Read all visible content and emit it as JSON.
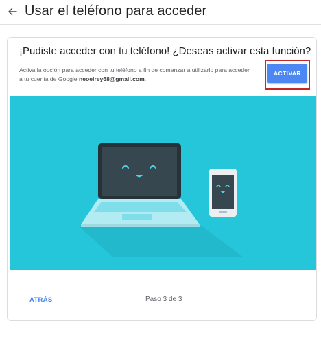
{
  "header": {
    "title": "Usar el teléfono para acceder",
    "back_icon": "arrow-left-icon"
  },
  "card": {
    "heading": "¡Pudiste acceder con tu teléfono! ¿Deseas activar esta función?",
    "description": "Activa la opción para acceder con tu teléfono a fin de comenzar a utilizarlo para acceder a tu cuenta de Google",
    "email": "neoelrey68@gmail.com",
    "period": ".",
    "activate_label": "ACTIVAR",
    "illustration_icons": [
      "laptop-icon",
      "smartphone-icon"
    ]
  },
  "footer": {
    "back_label": "ATRÁS",
    "step": "Paso 3 de 3"
  },
  "colors": {
    "accent": "#4d87f1",
    "highlight": "#c62828",
    "illustration_bg": "#26c6da"
  }
}
